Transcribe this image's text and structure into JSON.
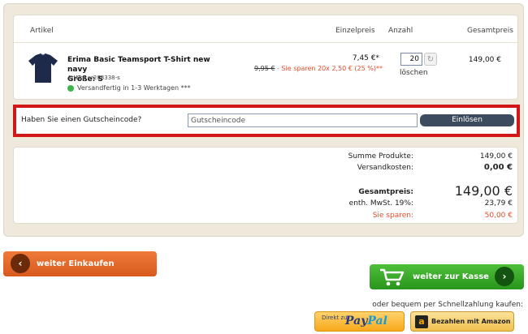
{
  "table_header": {
    "article": "Artikel",
    "unit_price": "Einzelpreis",
    "quantity": "Anzahl",
    "total_price": "Gesamtpreis"
  },
  "item": {
    "name": "Erima Basic Teamsport T-Shirt new navy",
    "size": "Größe: S",
    "article_no": "ArtNr.: er208338-s",
    "shipping": "Versandfertig in 1-3 Werktagen ***",
    "unit_price": "7,45 €*",
    "old_price": "9,95 €",
    "savings": " - Sie sparen 20x 2,50 € (25 %)**",
    "quantity": "20",
    "delete": "löschen",
    "total": "149,00 €",
    "shipping_status_color": "#3cb54a",
    "refresh_icon": "refresh-icon"
  },
  "voucher": {
    "label": "Haben Sie einen Gutscheincode?",
    "placeholder": "Gutscheincode",
    "button": "Einlösen"
  },
  "summary": {
    "products_label": "Summe Produkte:",
    "products_value": "149,00 €",
    "shipping_label": "Versandkosten:",
    "shipping_value": "0,00 €",
    "total_label": "Gesamtpreis:",
    "total_value": "149,00 €",
    "vat_label": "enth. MwSt. 19%:",
    "vat_value": "23,79 €",
    "saved_label": "Sie sparen:",
    "saved_value": "50,00 €"
  },
  "actions": {
    "continue_shopping": "weiter Einkaufen",
    "checkout": "weiter zur Kasse",
    "quick_pay_text": "oder bequem per Schnellzahlung kaufen:",
    "paypal_direct": "Direkt zu",
    "paypal_logo_a": "Pay",
    "paypal_logo_b": "Pal",
    "amazon": "Bezahlen mit Amazon"
  },
  "colors": {
    "highlight_border": "#d11717",
    "continue_button": "#e06a2b",
    "checkout_button": "#3aa82a",
    "savings_text": "#e74c2a"
  }
}
